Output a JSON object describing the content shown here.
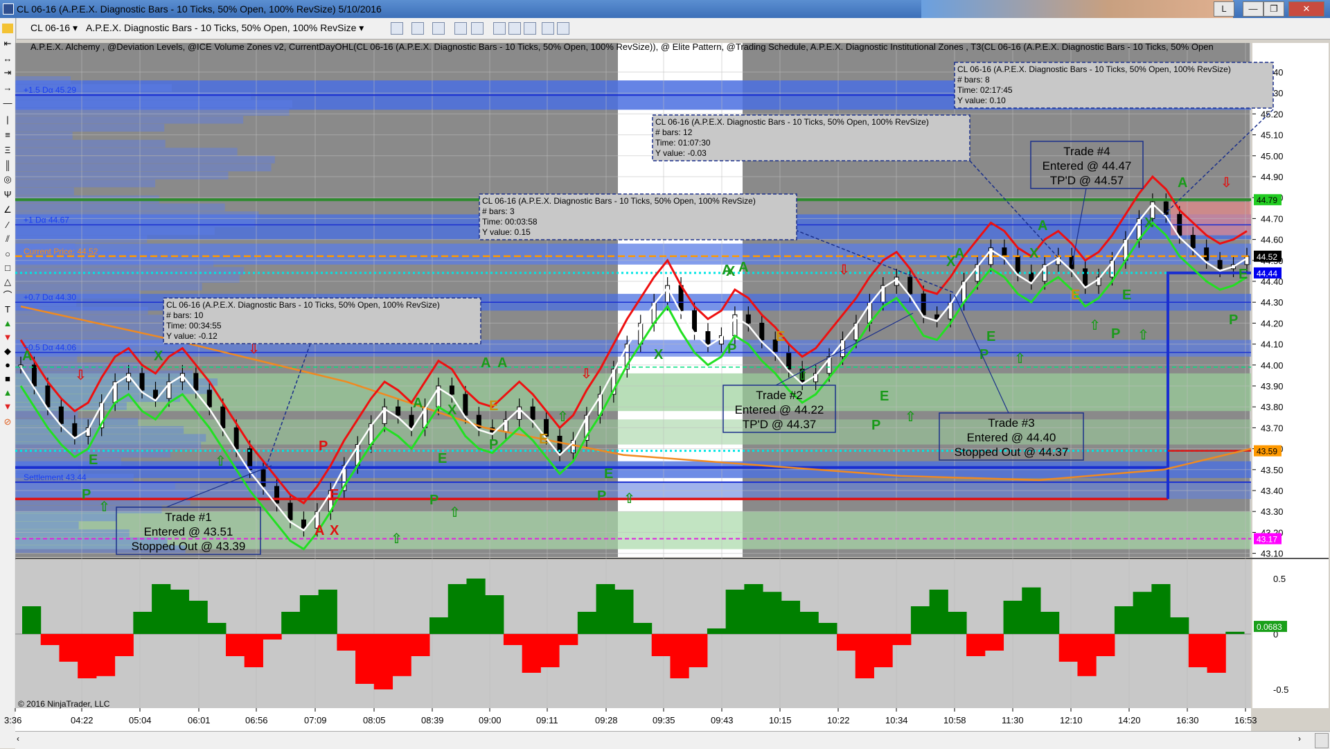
{
  "window": {
    "title": "CL 06-16 (A.P.E.X. Diagnostic Bars - 10 Ticks, 50% Open, 100% RevSize)  5/10/2016",
    "buttons": [
      "L",
      "—",
      "❐",
      "✕"
    ]
  },
  "toolbar": {
    "instrument": "CL 06-16",
    "bar_type": "A.P.E.X. Diagnostic Bars - 10 Ticks, 50% Open, 100% RevSize"
  },
  "indicator_line": "A.P.E.X. Alchemy , @Deviation Levels, @ICE Volume Zones v2, CurrentDayOHL(CL 06-16 (A.P.E.X. Diagnostic Bars - 10 Ticks, 50% Open, 100% RevSize)), @ Elite Pattern, @Trading Schedule, A.P.E.X. Diagnostic Institutional Zones , T3(CL 06-16 (A.P.E.X. Diagnostic Bars - 10 Ticks, 50% Open",
  "copyright": "© 2016 NinjaTrader, LLC",
  "price_axis": [
    "45.40",
    "45.30",
    "45.20",
    "45.10",
    "45.00",
    "44.90",
    "44.80",
    "44.70",
    "44.60",
    "44.50",
    "44.40",
    "44.30",
    "44.20",
    "44.10",
    "44.00",
    "43.90",
    "43.80",
    "43.70",
    "43.60",
    "43.50",
    "43.40",
    "43.30",
    "43.20",
    "43.10"
  ],
  "price_tags": [
    {
      "text": "44.79",
      "price": 44.79,
      "bg": "#22cc22",
      "fg": "#000000"
    },
    {
      "text": "44.52",
      "price": 44.52,
      "bg": "#000000",
      "fg": "#ffffff"
    },
    {
      "text": "44.44",
      "price": 44.44,
      "bg": "#0000ee",
      "fg": "#ffffff"
    },
    {
      "text": "43.59",
      "price": 43.59,
      "bg": "#ff9900",
      "fg": "#000000"
    },
    {
      "text": "43.17",
      "price": 43.17,
      "bg": "#ff00ff",
      "fg": "#ffffff"
    }
  ],
  "level_labels": [
    {
      "text": "+1.5 Dα 45.29",
      "price": 45.29
    },
    {
      "text": "+1 Dα 44.67",
      "price": 44.67
    },
    {
      "text": "Current Price: 44.52",
      "price": 44.52
    },
    {
      "text": "+0.7 Dα 44.30",
      "price": 44.3
    },
    {
      "text": "+0.5 Dα 44.06",
      "price": 44.06
    },
    {
      "text": "Settlement 43.44",
      "price": 43.44
    }
  ],
  "time_axis": [
    "3:36",
    "04:22",
    "05:04",
    "06:01",
    "06:56",
    "07:09",
    "08:05",
    "08:39",
    "09:00",
    "09:11",
    "09:28",
    "09:35",
    "09:43",
    "10:15",
    "10:22",
    "10:34",
    "10:58",
    "11:30",
    "12:10",
    "14:20",
    "16:30",
    "16:53"
  ],
  "osc_axis": [
    "0.5",
    "0",
    "-0.5"
  ],
  "osc_tag": "0.0683",
  "info_boxes": [
    {
      "lines": [
        "CL 06-16 (A.P.E.X. Diagnostic Bars - 10 Ticks, 50% Open, 100% RevSize)",
        "# bars:   10",
        "Time:     00:34:55",
        "Y value:  -0.12"
      ]
    },
    {
      "lines": [
        "CL 06-16 (A.P.E.X. Diagnostic Bars - 10 Ticks, 50% Open, 100% RevSize)",
        "# bars:   3",
        "Time:     00:03:58",
        "Y value:  0.15"
      ]
    },
    {
      "lines": [
        "CL 06-16 (A.P.E.X. Diagnostic Bars - 10 Ticks, 50% Open, 100% RevSize)",
        "# bars:   12",
        "Time:     01:07:30",
        "Y value:  -0.03"
      ]
    },
    {
      "lines": [
        "CL 06-16 (A.P.E.X. Diagnostic Bars - 10 Ticks, 50% Open, 100% RevSize)",
        "# bars:   8",
        "Time:     02:17:45",
        "Y value:  0.10"
      ]
    }
  ],
  "trade_boxes": [
    {
      "lines": [
        "Trade #1",
        "Entered @ 43.51",
        "Stopped Out @ 43.39"
      ]
    },
    {
      "lines": [
        "Trade #2",
        "Entered @ 44.22",
        "TP'D @ 44.37"
      ]
    },
    {
      "lines": [
        "Trade #3",
        "Entered @ 44.40",
        "Stopped Out @ 44.37"
      ]
    },
    {
      "lines": [
        "Trade #4",
        "Entered @ 44.47",
        "TP'D @ 44.57"
      ]
    }
  ],
  "signal_letters": [
    "A",
    "X",
    "E",
    "P"
  ],
  "colors": {
    "panel_bg": "#c8c8c8",
    "dark_zone": "#8a8a8a",
    "blue_zone": "#4a6fe0",
    "green_zone": "#90c890",
    "bull": "#008000",
    "bear": "#ff0000",
    "current_price": "#ff9900",
    "cyan_dots": "#00e5e5"
  }
}
